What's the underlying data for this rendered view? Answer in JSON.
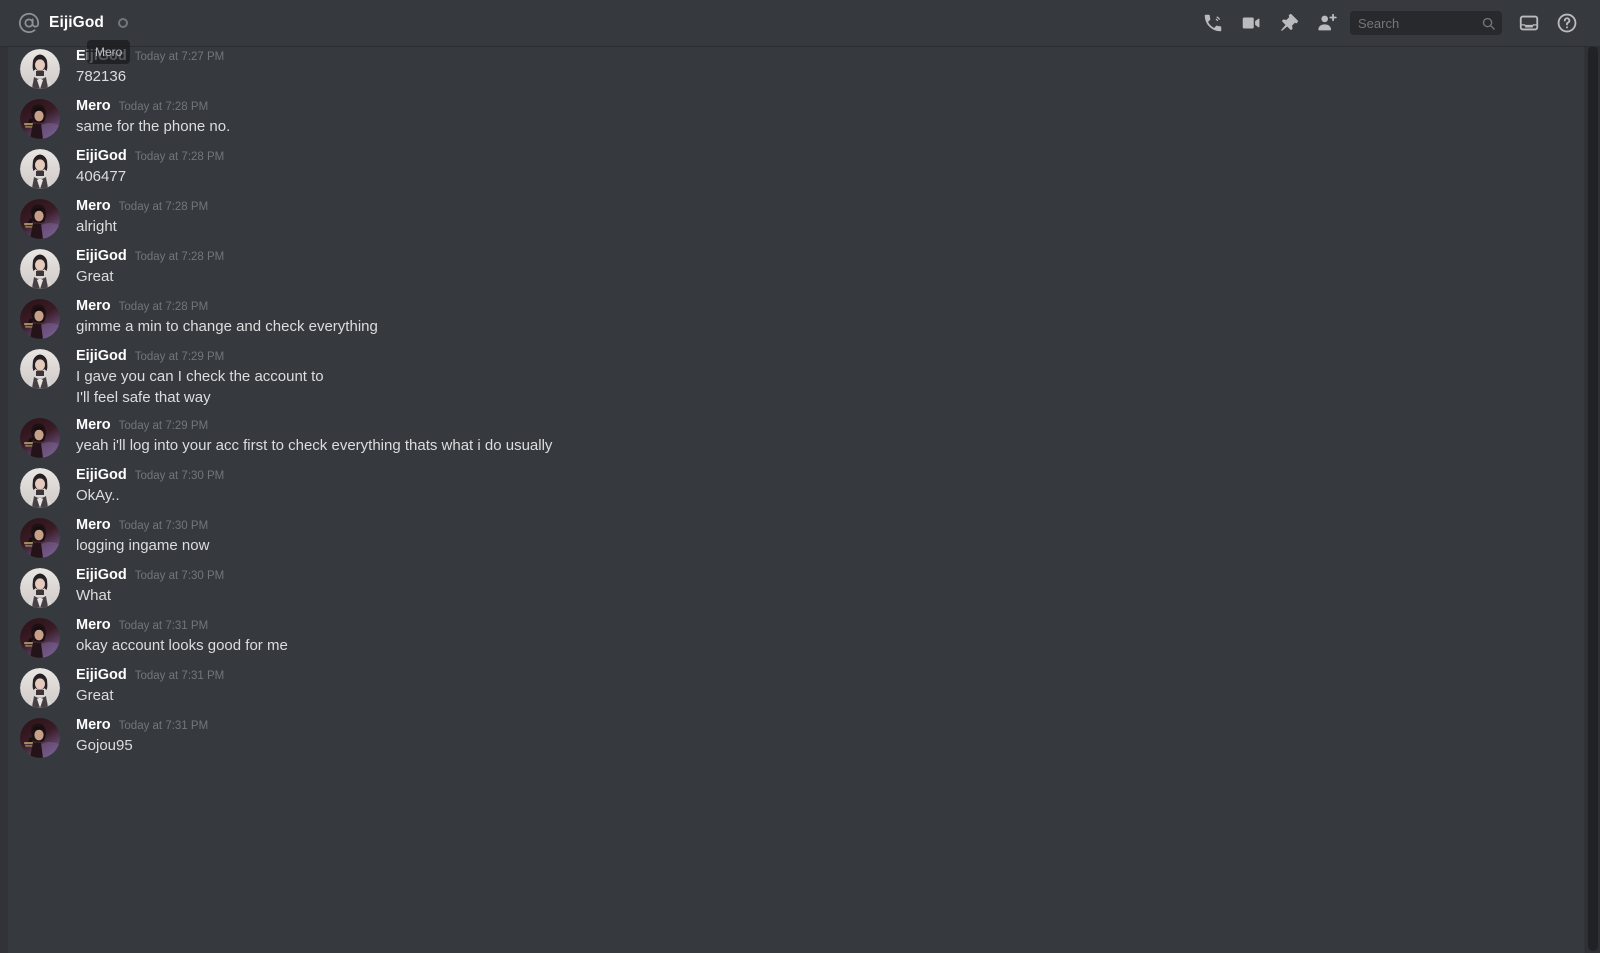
{
  "header": {
    "at_icon": "at-icon",
    "title": "EijiGod",
    "status_icon": "status-circle-icon",
    "actions": [
      {
        "name": "start-call-button",
        "icon": "phone-call-icon",
        "label": "Start Voice Call"
      },
      {
        "name": "start-video-call-button",
        "icon": "video-camera-icon",
        "label": "Start Video Call"
      },
      {
        "name": "pinned-messages-button",
        "icon": "pin-icon",
        "label": "Pinned Messages"
      },
      {
        "name": "add-friends-button",
        "icon": "add-person-icon",
        "label": "Add Friends to DM"
      }
    ],
    "search": {
      "placeholder": "Search",
      "value": "",
      "icon": "search-icon"
    },
    "inbox": {
      "name": "inbox-button",
      "icon": "inbox-icon",
      "label": "Inbox"
    },
    "help": {
      "name": "help-button",
      "icon": "help-circle-icon",
      "label": "Help"
    }
  },
  "hover_tooltip": {
    "text": "Mero"
  },
  "colors": {
    "app_background": "#36393e",
    "header_background": "#36393e",
    "text_primary": "#dcddde",
    "text_author": "#ffffff",
    "text_muted": "#72767d",
    "search_background": "#27292d",
    "scrollbar_thumb": "#202225"
  },
  "users": {
    "eijigod": {
      "name": "EijiGod",
      "avatar": "eijigod-avatar"
    },
    "mero": {
      "name": "Mero",
      "avatar": "mero-avatar"
    }
  },
  "messages": [
    {
      "author": "EijiGod",
      "avatar": "eijigod-avatar",
      "timestamp": "Today at 7:27 PM",
      "lines": [
        "782136"
      ]
    },
    {
      "author": "Mero",
      "avatar": "mero-avatar",
      "timestamp": "Today at 7:28 PM",
      "lines": [
        "same for the phone no."
      ]
    },
    {
      "author": "EijiGod",
      "avatar": "eijigod-avatar",
      "timestamp": "Today at 7:28 PM",
      "lines": [
        "406477"
      ]
    },
    {
      "author": "Mero",
      "avatar": "mero-avatar",
      "timestamp": "Today at 7:28 PM",
      "lines": [
        "alright"
      ]
    },
    {
      "author": "EijiGod",
      "avatar": "eijigod-avatar",
      "timestamp": "Today at 7:28 PM",
      "lines": [
        "Great"
      ]
    },
    {
      "author": "Mero",
      "avatar": "mero-avatar",
      "timestamp": "Today at 7:28 PM",
      "lines": [
        "gimme a min to change and check everything"
      ]
    },
    {
      "author": "EijiGod",
      "avatar": "eijigod-avatar",
      "timestamp": "Today at 7:29 PM",
      "lines": [
        "I gave you can I check the account to",
        "I'll feel safe that way"
      ]
    },
    {
      "author": "Mero",
      "avatar": "mero-avatar",
      "timestamp": "Today at 7:29 PM",
      "lines": [
        "yeah i'll log into your acc first to check everything thats what i do usually"
      ]
    },
    {
      "author": "EijiGod",
      "avatar": "eijigod-avatar",
      "timestamp": "Today at 7:30 PM",
      "lines": [
        "OkAy.."
      ]
    },
    {
      "author": "Mero",
      "avatar": "mero-avatar",
      "timestamp": "Today at 7:30 PM",
      "lines": [
        "logging ingame now"
      ]
    },
    {
      "author": "EijiGod",
      "avatar": "eijigod-avatar",
      "timestamp": "Today at 7:30 PM",
      "lines": [
        "What"
      ]
    },
    {
      "author": "Mero",
      "avatar": "mero-avatar",
      "timestamp": "Today at 7:31 PM",
      "lines": [
        "okay account looks good for me"
      ]
    },
    {
      "author": "EijiGod",
      "avatar": "eijigod-avatar",
      "timestamp": "Today at 7:31 PM",
      "lines": [
        "Great"
      ]
    },
    {
      "author": "Mero",
      "avatar": "mero-avatar",
      "timestamp": "Today at 7:31 PM",
      "lines": [
        "Gojou95"
      ]
    }
  ]
}
